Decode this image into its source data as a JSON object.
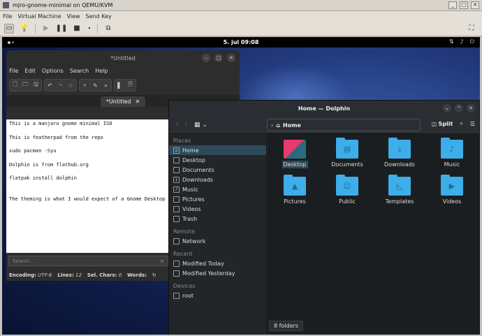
{
  "vm": {
    "title": "mjro-gnome-minimal on QEMU/KVM",
    "menu": [
      "File",
      "Virtual Machine",
      "View",
      "Send Key"
    ],
    "window_buttons": [
      "_",
      "□",
      "✕"
    ]
  },
  "guest": {
    "clock": "5. jul  09:08",
    "tray_icons": [
      "network-icon",
      "volume-icon",
      "power-icon"
    ]
  },
  "editor": {
    "title": "*Untitled",
    "menu": [
      "File",
      "Edit",
      "Options",
      "Search",
      "Help"
    ],
    "tab_label": "*Untitled",
    "lines": [
      "This is a manjaro gnome minimal ISO",
      "This is featherpad from the repo",
      "sudo pacman -Syu",
      "Dolphin is from flathub.org",
      "flatpak install dolphin",
      "",
      "The theming is what I would expect of a Gnome Desktop"
    ],
    "search_placeholder": "Search...",
    "status": {
      "encoding_label": "Encoding:",
      "encoding_value": "UTF-8",
      "lines_label": "Lines:",
      "lines_value": "12",
      "sel_label": "Sel. Chars:",
      "sel_value": "0",
      "words_label": "Words:"
    }
  },
  "dolphin": {
    "title": "Home — Dolphin",
    "location": "Home",
    "split_label": "Split",
    "places_header": "Places",
    "places": [
      "Home",
      "Desktop",
      "Documents",
      "Downloads",
      "Music",
      "Pictures",
      "Videos",
      "Trash"
    ],
    "remote_header": "Remote",
    "remote": [
      "Network"
    ],
    "recent_header": "Recent",
    "recent": [
      "Modified Today",
      "Modified Yesterday"
    ],
    "devices_header": "Devices",
    "devices": [
      "root"
    ],
    "folders": [
      "Desktop",
      "Documents",
      "Downloads",
      "Music",
      "Pictures",
      "Public",
      "Templates",
      "Videos"
    ],
    "status": "8 folders"
  }
}
